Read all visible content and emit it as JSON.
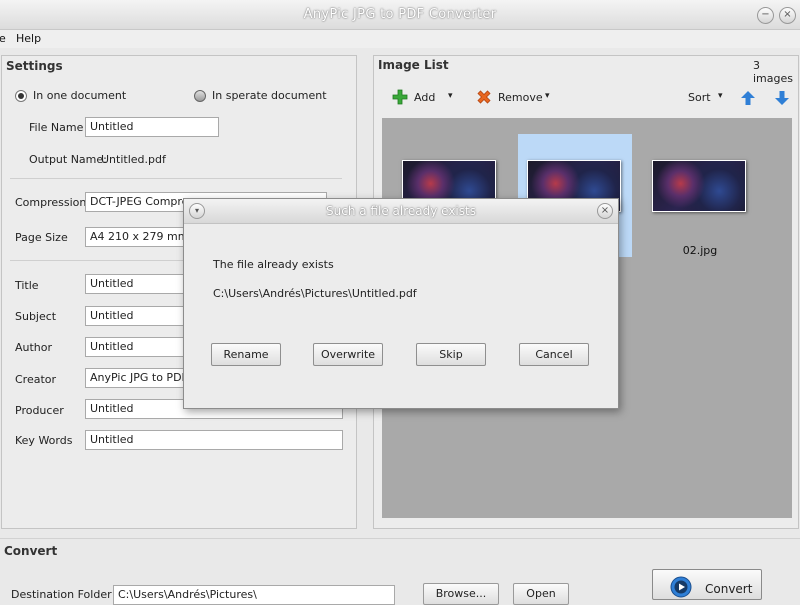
{
  "app": {
    "title": "AnyPic JPG to PDF Converter"
  },
  "menu": {
    "items": [
      "e",
      "Help"
    ]
  },
  "settings": {
    "title": "Settings",
    "radio_one": "In one document",
    "radio_separate": "In sperate document",
    "file_name_label": "File Name",
    "file_name_value": "Untitled",
    "output_name_label": "Output Name:",
    "output_name_value": "Untitled.pdf",
    "compression_label": "Compression",
    "compression_value": "DCT-JPEG Compress",
    "page_size_label": "Page Size",
    "page_size_value": "A4 210 x 279 mm",
    "meta": [
      {
        "label": "Title",
        "value": "Untitled"
      },
      {
        "label": "Subject",
        "value": "Untitled"
      },
      {
        "label": "Author",
        "value": "Untitled"
      },
      {
        "label": "Creator",
        "value": "AnyPic JPG to PDF C"
      },
      {
        "label": "Producer",
        "value": "Untitled"
      },
      {
        "label": "Key Words",
        "value": "Untitled"
      }
    ]
  },
  "image_list": {
    "title": "Image List",
    "count": "3 images",
    "add_label": "Add",
    "remove_label": "Remove",
    "sort_label": "Sort",
    "images": [
      {
        "name": ""
      },
      {
        "name": ""
      },
      {
        "name": "02.jpg"
      }
    ]
  },
  "dialog": {
    "title": "Such a file already exists",
    "message": "The file already exists",
    "path": "C:\\Users\\Andrés\\Pictures\\Untitled.pdf",
    "buttons": [
      "Rename",
      "Overwrite",
      "Skip",
      "Cancel"
    ]
  },
  "convert": {
    "title": "Convert",
    "dest_label": "Destination Folder",
    "dest_value": "C:\\Users\\Andrés\\Pictures\\",
    "browse_label": "Browse...",
    "open_label": "Open",
    "convert_label": "Convert"
  },
  "colors": {
    "accent_blue": "#2f7fd6",
    "add_green": "#3aa83a",
    "remove_orange": "#e8661f",
    "selection": "#bcd9f7"
  }
}
